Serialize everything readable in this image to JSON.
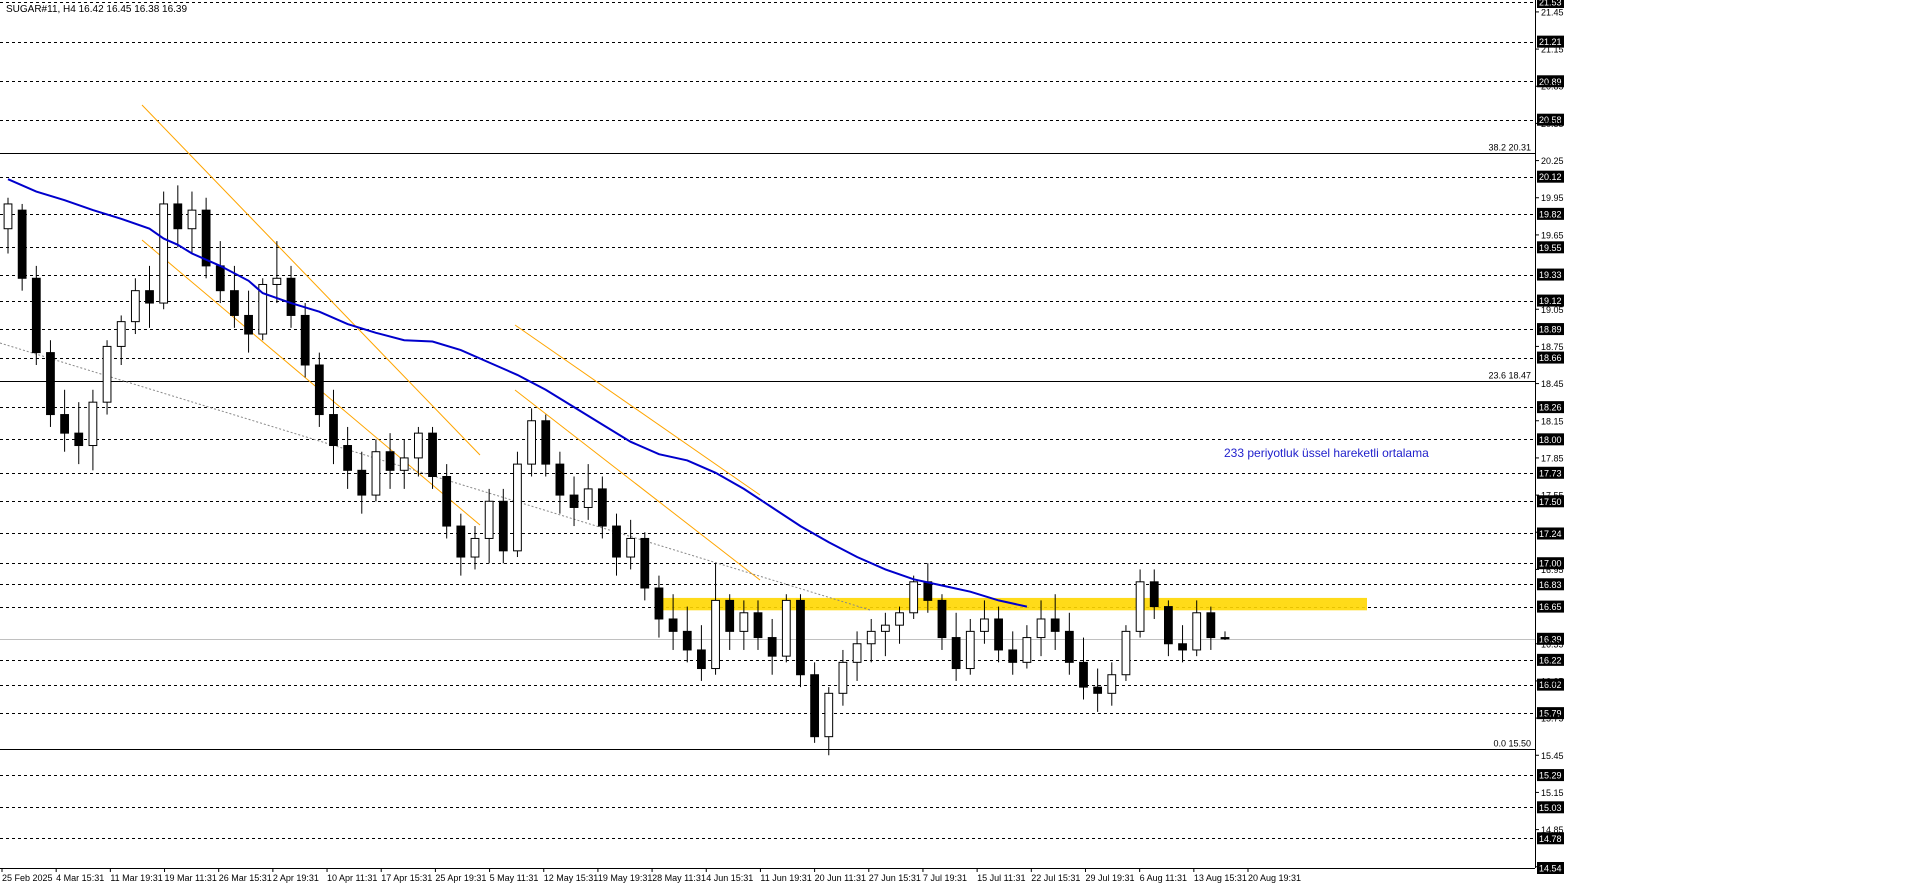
{
  "header": {
    "symbol_ohlc": "SUGAR#11, H4  16.42 16.45 16.38 16.39"
  },
  "ema_annotation": "233 periyotluk üssel hareketli ortalama",
  "colors": {
    "ema": "#0000cc",
    "channel": "#ffa500",
    "zone": "#ffd700",
    "candle": "#000000",
    "label_bg": "#000000",
    "dashed_line": "#000000",
    "diagonal": "#888888"
  },
  "chart_data": {
    "type": "candlestick",
    "symbol": "SUGAR#11",
    "timeframe": "H4",
    "last_ohlc": {
      "open": 16.42,
      "high": 16.45,
      "low": 16.38,
      "close": 16.39
    },
    "ylim": [
      14.54,
      21.53
    ],
    "x_tick_labels": [
      "25 Feb 2025",
      "4 Mar 15:31",
      "11 Mar 19:31",
      "19 Mar 11:31",
      "26 Mar 15:31",
      "2 Apr 19:31",
      "10 Apr 11:31",
      "17 Apr 15:31",
      "25 Apr 19:31",
      "5 May 11:31",
      "12 May 15:31",
      "19 May 19:31",
      "28 May 11:31",
      "4 Jun 15:31",
      "11 Jun 19:31",
      "20 Jun 11:31",
      "27 Jun 15:31",
      "7 Jul 19:31",
      "15 Jul 11:31",
      "22 Jul 15:31",
      "29 Jul 19:31",
      "6 Aug 11:31",
      "13 Aug 15:31",
      "20 Aug 19:31"
    ],
    "y_axis_ticks": [
      "21.53",
      "21.45",
      "21.21",
      "21.15",
      "20.89",
      "20.85",
      "20.58",
      "20.55",
      "20.25",
      "20.12",
      "19.95",
      "19.82",
      "19.65",
      "19.55",
      "19.33",
      "19.12",
      "19.05",
      "18.89",
      "18.75",
      "18.66",
      "18.45",
      "18.26",
      "18.15",
      "18.00",
      "17.85",
      "17.73",
      "17.55",
      "17.50",
      "17.25",
      "17.24",
      "17.00",
      "16.95",
      "16.83",
      "16.65",
      "16.39",
      "16.35",
      "16.22",
      "16.02",
      "16.05",
      "15.79",
      "15.75",
      "15.45",
      "15.29",
      "15.15",
      "15.03",
      "14.85",
      "14.78",
      "14.55",
      "14.54"
    ],
    "horizontal_levels": [
      "21.53",
      "21.21",
      "20.89",
      "20.58",
      "20.12",
      "19.82",
      "19.55",
      "19.33",
      "19.12",
      "18.89",
      "18.66",
      "18.26",
      "18.00",
      "17.73",
      "17.50",
      "17.24",
      "17.00",
      "16.83",
      "16.65",
      "16.39",
      "16.22",
      "16.02",
      "15.79",
      "15.29",
      "15.03",
      "14.78",
      "14.54"
    ],
    "fibonacci_levels": [
      {
        "label": "38.2 20.31",
        "value": 20.31
      },
      {
        "label": "23.6 18.47",
        "value": 18.47
      },
      {
        "label": "0.0 15.50",
        "value": 15.5
      }
    ],
    "resistance_zone": [
      16.62,
      16.72
    ],
    "ema_series": [
      [
        0,
        20.1
      ],
      [
        2,
        20.0
      ],
      [
        4,
        19.93
      ],
      [
        6,
        19.85
      ],
      [
        8,
        19.78
      ],
      [
        10,
        19.7
      ],
      [
        11,
        19.62
      ],
      [
        12,
        19.57
      ],
      [
        13,
        19.5
      ],
      [
        15,
        19.4
      ],
      [
        17,
        19.28
      ],
      [
        18,
        19.18
      ],
      [
        20,
        19.1
      ],
      [
        22,
        19.03
      ],
      [
        24,
        18.93
      ],
      [
        26,
        18.86
      ],
      [
        28,
        18.8
      ],
      [
        30,
        18.79
      ],
      [
        32,
        18.72
      ],
      [
        34,
        18.62
      ],
      [
        36,
        18.52
      ],
      [
        38,
        18.4
      ],
      [
        40,
        18.26
      ],
      [
        42,
        18.12
      ],
      [
        44,
        17.98
      ],
      [
        46,
        17.88
      ],
      [
        48,
        17.83
      ],
      [
        50,
        17.73
      ],
      [
        52,
        17.6
      ],
      [
        54,
        17.45
      ],
      [
        56,
        17.3
      ],
      [
        58,
        17.17
      ],
      [
        60,
        17.05
      ],
      [
        62,
        16.95
      ],
      [
        64,
        16.87
      ],
      [
        66,
        16.82
      ],
      [
        68,
        16.77
      ],
      [
        70,
        16.7
      ],
      [
        72,
        16.65
      ]
    ],
    "candles": [
      [
        0,
        19.7,
        19.95,
        19.5,
        19.9
      ],
      [
        1,
        19.85,
        19.9,
        19.2,
        19.3
      ],
      [
        2,
        19.3,
        19.4,
        18.6,
        18.7
      ],
      [
        3,
        18.7,
        18.8,
        18.1,
        18.2
      ],
      [
        4,
        18.2,
        18.4,
        17.9,
        18.05
      ],
      [
        5,
        18.05,
        18.3,
        17.8,
        17.95
      ],
      [
        6,
        17.95,
        18.4,
        17.75,
        18.3
      ],
      [
        7,
        18.3,
        18.8,
        18.2,
        18.75
      ],
      [
        8,
        18.75,
        19.0,
        18.6,
        18.95
      ],
      [
        9,
        18.95,
        19.3,
        18.85,
        19.2
      ],
      [
        10,
        19.2,
        19.4,
        18.9,
        19.1
      ],
      [
        11,
        19.1,
        20.0,
        19.05,
        19.9
      ],
      [
        12,
        19.9,
        20.05,
        19.55,
        19.7
      ],
      [
        13,
        19.7,
        20.0,
        19.5,
        19.85
      ],
      [
        14,
        19.85,
        19.95,
        19.3,
        19.4
      ],
      [
        15,
        19.4,
        19.6,
        19.1,
        19.2
      ],
      [
        16,
        19.2,
        19.4,
        18.9,
        19.0
      ],
      [
        17,
        19.0,
        19.2,
        18.7,
        18.85
      ],
      [
        18,
        18.85,
        19.3,
        18.8,
        19.25
      ],
      [
        19,
        19.25,
        19.6,
        19.1,
        19.3
      ],
      [
        20,
        19.3,
        19.4,
        18.9,
        19.0
      ],
      [
        21,
        19.0,
        19.1,
        18.5,
        18.6
      ],
      [
        22,
        18.6,
        18.7,
        18.1,
        18.2
      ],
      [
        23,
        18.2,
        18.4,
        17.8,
        17.95
      ],
      [
        24,
        17.95,
        18.1,
        17.6,
        17.75
      ],
      [
        25,
        17.75,
        17.9,
        17.4,
        17.55
      ],
      [
        26,
        17.55,
        18.0,
        17.5,
        17.9
      ],
      [
        27,
        17.9,
        18.05,
        17.6,
        17.75
      ],
      [
        28,
        17.75,
        18.0,
        17.6,
        17.85
      ],
      [
        29,
        17.85,
        18.1,
        17.7,
        18.05
      ],
      [
        30,
        18.05,
        18.1,
        17.6,
        17.7
      ],
      [
        31,
        17.7,
        17.8,
        17.2,
        17.3
      ],
      [
        32,
        17.3,
        17.4,
        16.9,
        17.05
      ],
      [
        33,
        17.05,
        17.3,
        16.95,
        17.2
      ],
      [
        34,
        17.2,
        17.6,
        17.0,
        17.5
      ],
      [
        35,
        17.5,
        17.6,
        17.0,
        17.1
      ],
      [
        36,
        17.1,
        17.9,
        17.05,
        17.8
      ],
      [
        37,
        17.8,
        18.25,
        17.7,
        18.15
      ],
      [
        38,
        18.15,
        18.2,
        17.7,
        17.8
      ],
      [
        39,
        17.8,
        17.9,
        17.4,
        17.55
      ],
      [
        40,
        17.55,
        17.7,
        17.3,
        17.45
      ],
      [
        41,
        17.45,
        17.8,
        17.35,
        17.6
      ],
      [
        42,
        17.6,
        17.7,
        17.2,
        17.3
      ],
      [
        43,
        17.3,
        17.4,
        16.9,
        17.05
      ],
      [
        44,
        17.05,
        17.35,
        16.95,
        17.2
      ],
      [
        45,
        17.2,
        17.25,
        16.7,
        16.8
      ],
      [
        46,
        16.8,
        16.9,
        16.4,
        16.55
      ],
      [
        47,
        16.55,
        16.75,
        16.3,
        16.45
      ],
      [
        48,
        16.45,
        16.65,
        16.2,
        16.3
      ],
      [
        49,
        16.3,
        16.5,
        16.05,
        16.15
      ],
      [
        50,
        16.15,
        17.0,
        16.1,
        16.7
      ],
      [
        51,
        16.7,
        16.75,
        16.3,
        16.45
      ],
      [
        52,
        16.45,
        16.7,
        16.3,
        16.6
      ],
      [
        53,
        16.6,
        16.7,
        16.3,
        16.4
      ],
      [
        54,
        16.4,
        16.55,
        16.1,
        16.25
      ],
      [
        55,
        16.25,
        16.75,
        16.2,
        16.7
      ],
      [
        56,
        16.7,
        16.75,
        16.0,
        16.1
      ],
      [
        57,
        16.1,
        16.2,
        15.55,
        15.6
      ],
      [
        58,
        15.6,
        16.0,
        15.45,
        15.95
      ],
      [
        59,
        15.95,
        16.3,
        15.85,
        16.2
      ],
      [
        60,
        16.2,
        16.45,
        16.05,
        16.35
      ],
      [
        61,
        16.35,
        16.55,
        16.2,
        16.45
      ],
      [
        62,
        16.45,
        16.6,
        16.25,
        16.5
      ],
      [
        63,
        16.5,
        16.65,
        16.35,
        16.6
      ],
      [
        64,
        16.6,
        16.9,
        16.55,
        16.85
      ],
      [
        65,
        16.85,
        17.0,
        16.6,
        16.7
      ],
      [
        66,
        16.7,
        16.75,
        16.3,
        16.4
      ],
      [
        67,
        16.4,
        16.6,
        16.05,
        16.15
      ],
      [
        68,
        16.15,
        16.55,
        16.1,
        16.45
      ],
      [
        69,
        16.45,
        16.7,
        16.35,
        16.55
      ],
      [
        70,
        16.55,
        16.65,
        16.2,
        16.3
      ],
      [
        71,
        16.3,
        16.45,
        16.1,
        16.2
      ],
      [
        72,
        16.2,
        16.5,
        16.15,
        16.4
      ],
      [
        73,
        16.4,
        16.7,
        16.25,
        16.55
      ],
      [
        74,
        16.55,
        16.75,
        16.3,
        16.45
      ],
      [
        75,
        16.45,
        16.6,
        16.1,
        16.2
      ],
      [
        76,
        16.2,
        16.4,
        15.9,
        16.0
      ],
      [
        77,
        16.0,
        16.15,
        15.8,
        15.95
      ],
      [
        78,
        15.95,
        16.2,
        15.85,
        16.1
      ],
      [
        79,
        16.1,
        16.5,
        16.05,
        16.45
      ],
      [
        80,
        16.45,
        16.95,
        16.4,
        16.85
      ],
      [
        81,
        16.85,
        16.95,
        16.55,
        16.65
      ],
      [
        82,
        16.65,
        16.7,
        16.25,
        16.35
      ],
      [
        83,
        16.35,
        16.5,
        16.2,
        16.3
      ],
      [
        84,
        16.3,
        16.7,
        16.25,
        16.6
      ],
      [
        85,
        16.6,
        16.65,
        16.3,
        16.4
      ],
      [
        86,
        16.4,
        16.45,
        16.38,
        16.39
      ]
    ]
  }
}
